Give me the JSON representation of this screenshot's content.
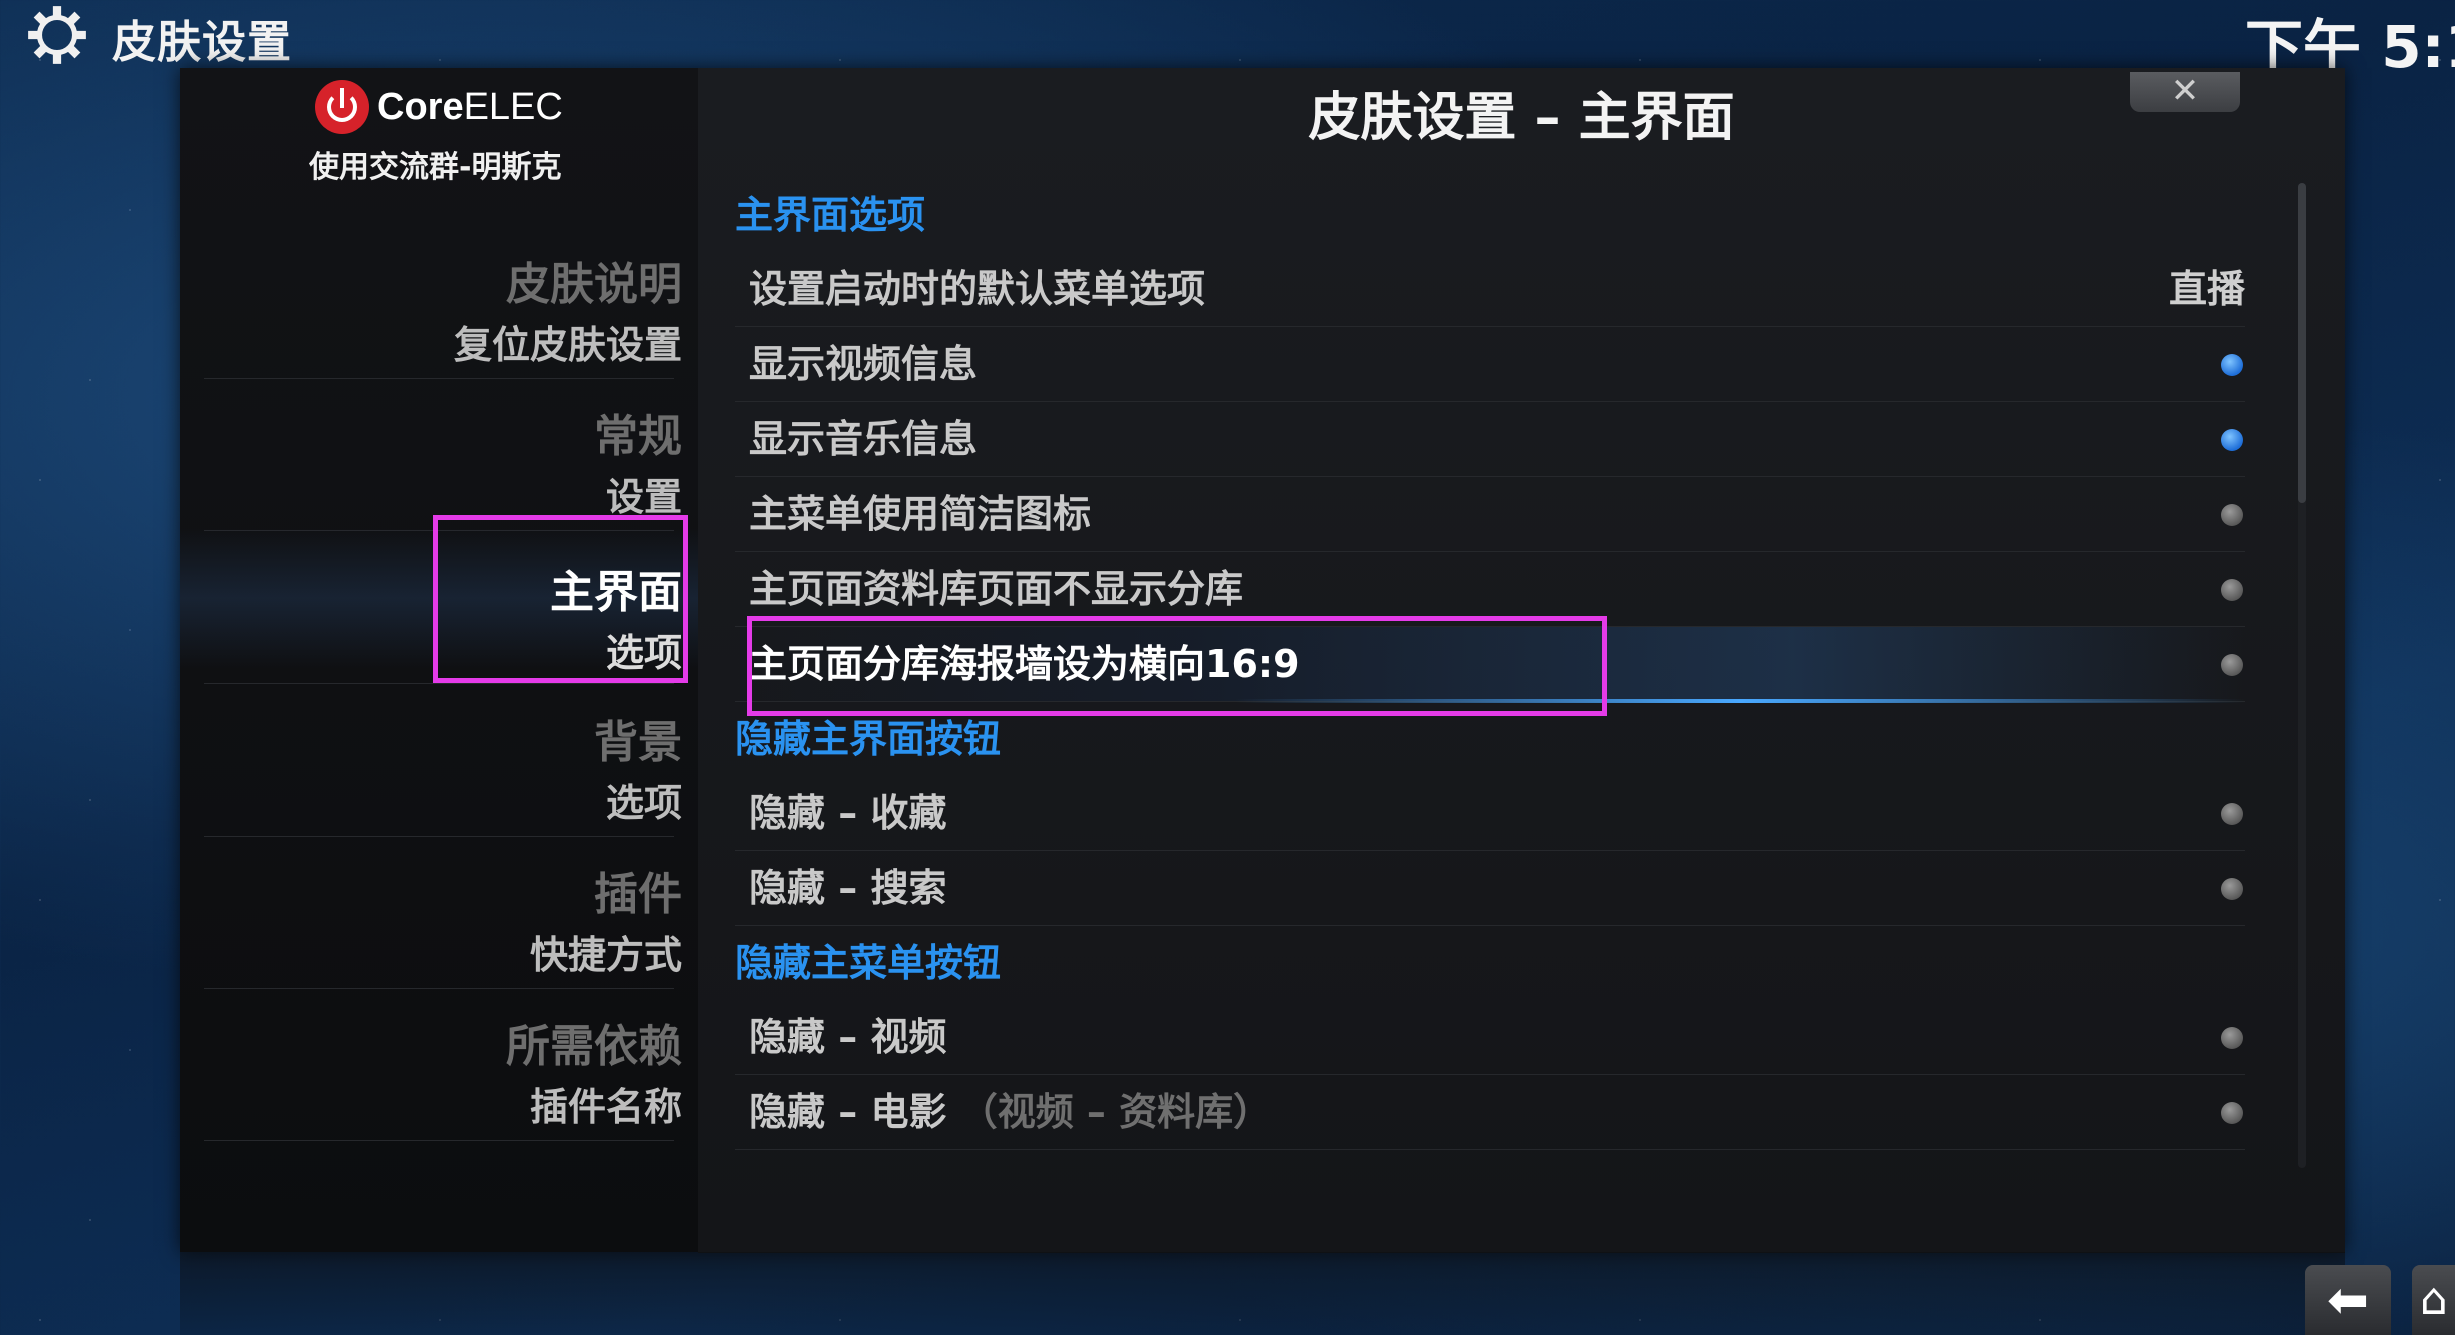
{
  "topbar": {
    "title": "皮肤设置",
    "clock": "下午 5:1"
  },
  "logo": {
    "brand_bold": "Core",
    "brand_rest": "ELEC",
    "subtitle": "使用交流群-明斯克"
  },
  "header": {
    "title": "皮肤设置 – 主界面",
    "close_glyph": "✕"
  },
  "nav": [
    {
      "l1": "皮肤说明",
      "l2": "复位皮肤设置"
    },
    {
      "l1": "常规",
      "l2": "设置"
    },
    {
      "l1": "主界面",
      "l2": "选项"
    },
    {
      "l1": "背景",
      "l2": "选项"
    },
    {
      "l1": "插件",
      "l2": "快捷方式"
    },
    {
      "l1": "所需依赖",
      "l2": "插件名称"
    }
  ],
  "sections": {
    "s1": "主界面选项",
    "s2": "隐藏主界面按钮",
    "s3": "隐藏主菜单按钮"
  },
  "rows": {
    "r1": {
      "label": "设置启动时的默认菜单选项",
      "value": "直播"
    },
    "r2": {
      "label": "显示视频信息",
      "state": "on"
    },
    "r3": {
      "label": "显示音乐信息",
      "state": "on"
    },
    "r4": {
      "label": "主菜单使用简洁图标",
      "state": "off"
    },
    "r5": {
      "label": "主页面资料库页面不显示分库",
      "state": "off"
    },
    "r6": {
      "label": "主页面分库海报墙设为横向16:9",
      "state": "off"
    },
    "r7": {
      "label": "隐藏 – 收藏",
      "state": "off"
    },
    "r8": {
      "label": "隐藏 – 搜索",
      "state": "off"
    },
    "r9": {
      "label": "隐藏 – 视频",
      "state": "off"
    },
    "r10": {
      "label": "隐藏 – 电影",
      "muted": "（视频 – 资料库）",
      "state": "off"
    }
  },
  "colors": {
    "accent": "#2a92f0",
    "highlight_box": "#e43be8",
    "toggle_on": "#1e6ed8"
  },
  "footer": {
    "back_glyph": "⬅",
    "home_glyph": "⌂"
  }
}
